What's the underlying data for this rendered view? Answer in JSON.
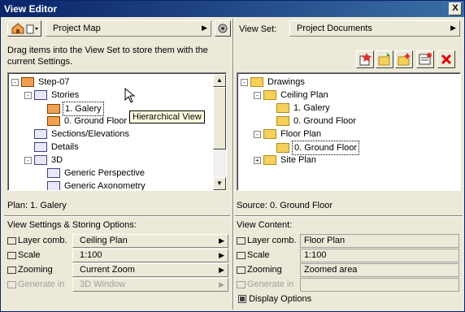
{
  "window": {
    "title": "View Editor",
    "close": "X"
  },
  "left": {
    "map_label": "Project Map",
    "instruction": "Drag items into the View Set to store them with the current Settings.",
    "tree": [
      {
        "label": "Step-07",
        "indent": 0,
        "toggle": "-",
        "icon": "house-icon"
      },
      {
        "label": "Stories",
        "indent": 1,
        "toggle": "-",
        "icon": "stories-icon"
      },
      {
        "label": "1. Galery",
        "indent": 2,
        "toggle": "",
        "icon": "story-icon",
        "selected": true
      },
      {
        "label": "0. Ground Floor",
        "indent": 2,
        "toggle": "",
        "icon": "story-icon"
      },
      {
        "label": "Sections/Elevations",
        "indent": 1,
        "toggle": "",
        "icon": "section-icon"
      },
      {
        "label": "Details",
        "indent": 1,
        "toggle": "",
        "icon": "details-icon"
      },
      {
        "label": "3D",
        "indent": 1,
        "toggle": "-",
        "icon": "3d-icon"
      },
      {
        "label": "Generic Perspective",
        "indent": 2,
        "toggle": "",
        "icon": "camera-icon"
      },
      {
        "label": "Generic Axonometry",
        "indent": 2,
        "toggle": "",
        "icon": "axonometry-icon"
      }
    ],
    "tooltip": "Hierarchical View",
    "status": "Plan: 1. Galery",
    "settings_heading": "View Settings & Storing Options:",
    "rows": [
      {
        "label": "Layer comb.",
        "value": "Ceiling Plan",
        "disabled": false
      },
      {
        "label": "Scale",
        "value": "1:100",
        "disabled": false
      },
      {
        "label": "Zooming",
        "value": "Current Zoom",
        "disabled": false
      },
      {
        "label": "Generate in",
        "value": "3D Window",
        "disabled": true
      }
    ]
  },
  "right": {
    "viewset_label": "View Set:",
    "viewset_value": "Project Documents",
    "tree": [
      {
        "label": "Drawings",
        "indent": 0,
        "toggle": "-"
      },
      {
        "label": "Ceiling Plan",
        "indent": 1,
        "toggle": "-"
      },
      {
        "label": "1. Galery",
        "indent": 2,
        "toggle": ""
      },
      {
        "label": "0. Ground Floor",
        "indent": 2,
        "toggle": ""
      },
      {
        "label": "Floor Plan",
        "indent": 1,
        "toggle": "-"
      },
      {
        "label": "0. Ground Floor",
        "indent": 2,
        "toggle": "",
        "selected": true
      },
      {
        "label": "Site Plan",
        "indent": 1,
        "toggle": "+"
      }
    ],
    "status": "Source: 0. Ground Floor",
    "content_heading": "View Content:",
    "rows": [
      {
        "label": "Layer comb.",
        "value": "Floor Plan",
        "disabled": false
      },
      {
        "label": "Scale",
        "value": "1:100",
        "disabled": false
      },
      {
        "label": "Zooming",
        "value": "Zoomed area",
        "disabled": false
      },
      {
        "label": "Generate in",
        "value": "",
        "disabled": true
      }
    ],
    "display_options": "Display Options"
  }
}
